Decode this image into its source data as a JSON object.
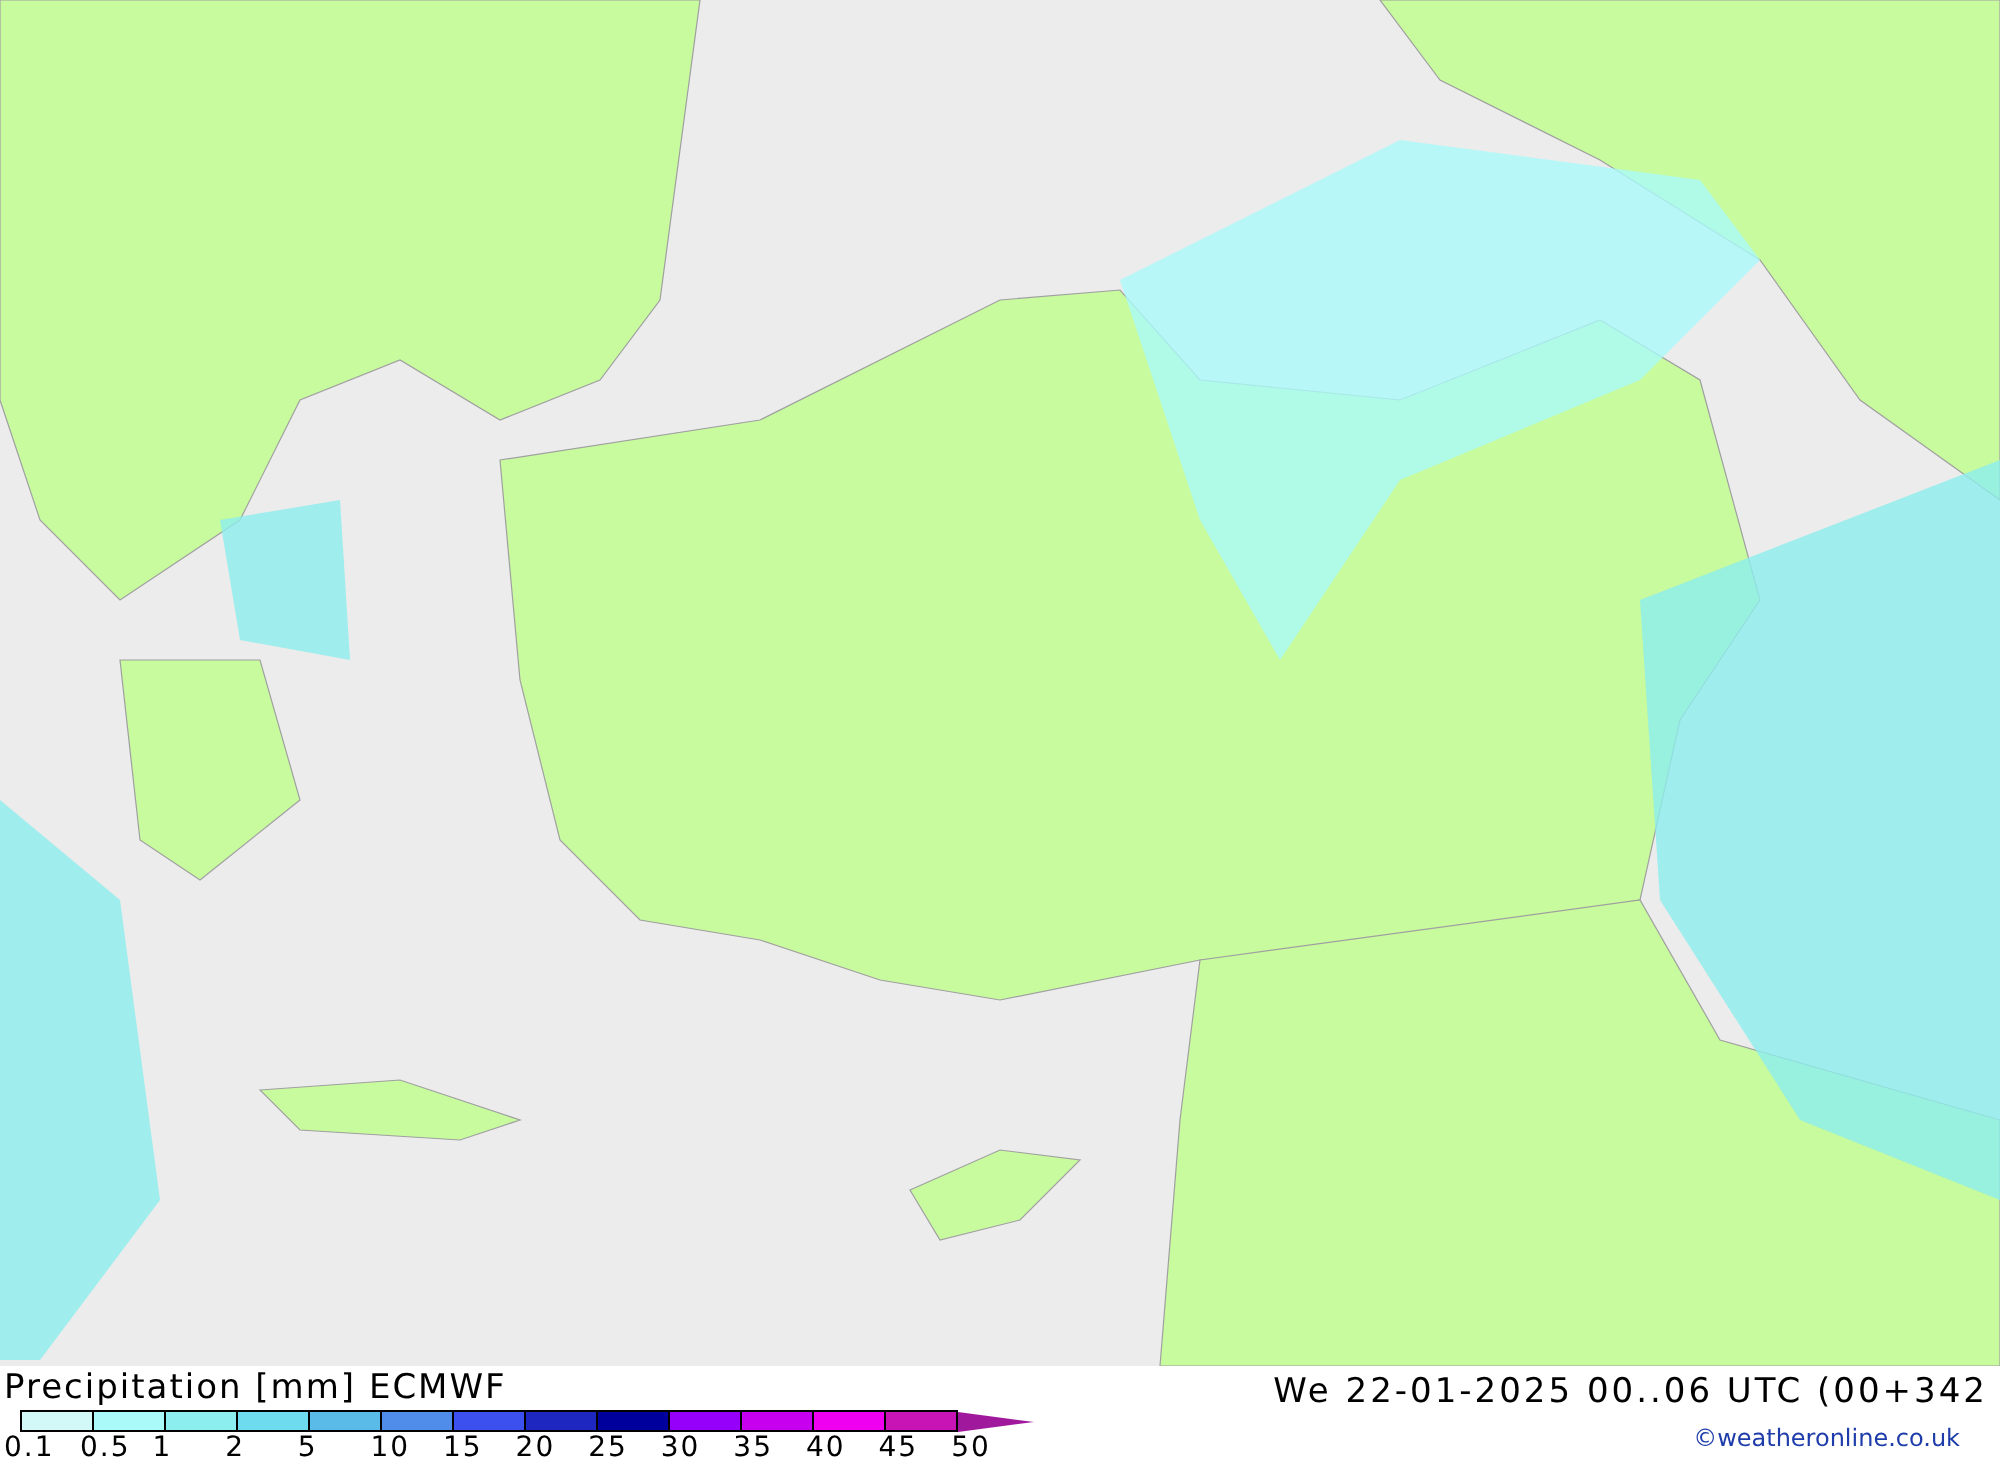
{
  "legend": {
    "title": "Precipitation [mm] ECMWF",
    "scale": [
      {
        "color": "#d2f8f8"
      },
      {
        "color": "#aafafa"
      },
      {
        "color": "#8ceeee"
      },
      {
        "color": "#6edcee"
      },
      {
        "color": "#5abae8"
      },
      {
        "color": "#508cea"
      },
      {
        "color": "#3c50f0"
      },
      {
        "color": "#1e28c0"
      },
      {
        "color": "#00009c"
      },
      {
        "color": "#9600fa"
      },
      {
        "color": "#c800f0"
      },
      {
        "color": "#f000f0"
      },
      {
        "color": "#c814b4"
      }
    ],
    "overflow": {
      "color": "#a0189c"
    },
    "labels": [
      "0.1",
      "0.5",
      "1",
      "2",
      "5",
      "10",
      "15",
      "20",
      "25",
      "30",
      "35",
      "40",
      "45",
      "50"
    ]
  },
  "timestamp": "We 22-01-2025 00..06 UTC (00+342",
  "credit": "©weatheronline.co.uk"
}
